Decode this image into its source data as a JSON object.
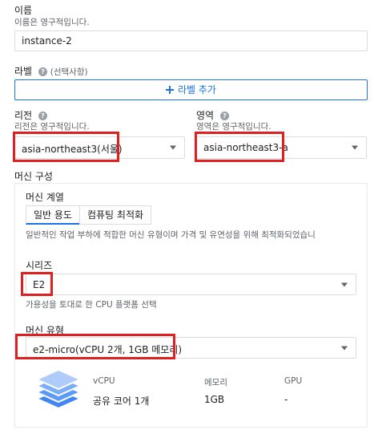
{
  "name": {
    "label": "이름",
    "hint": "이름은 영구적입니다.",
    "value": "instance-2"
  },
  "labels": {
    "label": "라벨",
    "optional": "(선택사항)",
    "add_button": "라벨 추가"
  },
  "region": {
    "label": "리전",
    "hint": "리전은 영구적입니다.",
    "value": "asia-northeast3(서울)"
  },
  "zone": {
    "label": "영역",
    "hint": "영역은 영구적입니다.",
    "value": "asia-northeast3-a"
  },
  "machine_config": {
    "title": "머신 구성",
    "family_label": "머신 계열",
    "tabs": [
      "일반 용도",
      "컴퓨팅 최적화"
    ],
    "description": "일반적인 작업 부하에 적합한 머신 유형이며 가격 및 유연성을 위해 최적화되었습니",
    "series_label": "시리즈",
    "series_value": "E2",
    "series_hint": "가용성을 토대로 한 CPU 플랫폼 선택",
    "type_label": "머신 유형",
    "type_value": "e2-micro(vCPU 2개, 1GB 메모리)",
    "spec": {
      "headers": [
        "vCPU",
        "메모리",
        "GPU"
      ],
      "values": [
        "공유 코어 1개",
        "1GB",
        "-"
      ]
    }
  },
  "icons": {
    "help": "help-icon",
    "add": "plus-icon",
    "dropdown": "dropdown-arrow-icon",
    "stack": "layers-stack-icon"
  },
  "colors": {
    "accent": "#1a73e8",
    "highlight": "#e0201e",
    "text": "#202124",
    "secondary": "#5f6368",
    "border": "#dadce0"
  }
}
